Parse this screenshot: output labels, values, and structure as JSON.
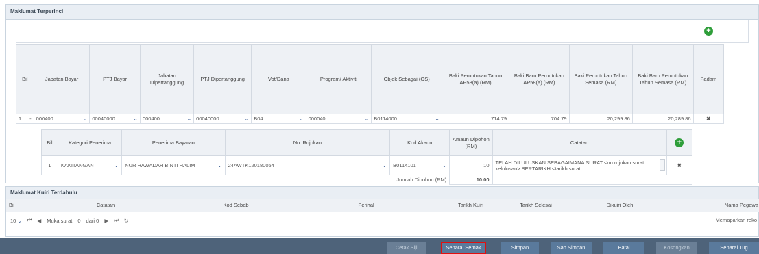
{
  "panel1": {
    "title": "Maklumat Terperinci"
  },
  "main_table": {
    "headers": [
      "Bil",
      "Jabatan Bayar",
      "PTJ Bayar",
      "Jabatan Dipertanggung",
      "PTJ Dipertanggung",
      "Vot/Dana",
      "Program/ Aktiviti",
      "Objek Sebagai (OS)",
      "Baki Peruntukan Tahun AP58(a) (RM)",
      "Baki Baru Peruntukan AP58(a) (RM)",
      "Baki Peruntukan Tahun Semasa (RM)",
      "Baki Baru Peruntukan Tahun Semasa (RM)",
      "Padam"
    ],
    "row": {
      "bil": "1",
      "toggle": "-",
      "jabatan_bayar": "000400",
      "ptj_bayar": "00040000",
      "jabatan_dip": "000400",
      "ptj_dip": "00040000",
      "vot": "B04",
      "program": "000040",
      "objek": "B0114000",
      "baki1": "714.79",
      "baki2": "704.79",
      "baki3": "20,299.86",
      "baki4": "20,289.86"
    }
  },
  "sub_table": {
    "headers": [
      "Bil",
      "Kategori Penerima",
      "Penerima Bayaran",
      "No. Rujukan",
      "Kod Akaun",
      "Amaun Dipohon (RM)",
      "Catatan"
    ],
    "row": {
      "bil": "1",
      "kategori": "KAKITANGAN",
      "penerima": "NUR HAWADAH BINTI HALIM",
      "rujukan": "24AWTK120180054",
      "kod": "B0114101",
      "amaun": "10",
      "catatan": "TELAH DILULUSKAN SEBAGAIMANA SURAT <no rujukan surat kelulusan> BERTARIKH <tarikh surat"
    },
    "sum_label": "Jumlah Dipohon (RM)",
    "sum_value": "10.00"
  },
  "panel2": {
    "title": "Maklumat Kuiri Terdahulu",
    "headers": [
      "Bil",
      "Catatan",
      "Kod Sebab",
      "Perihal",
      "Tarikh Kuiri",
      "Tarikh Selesai",
      "Dikuiri Oleh",
      "Nama Pegawa"
    ],
    "pager": {
      "page_size": "10",
      "page_label": "Muka surat",
      "page": "0",
      "of_label": "dari 0",
      "info": "Memaparkan reko"
    }
  },
  "buttons": {
    "cetak": "Cetak Sijil",
    "senarai_semak": "Senarai Semak",
    "simpan": "Simpan",
    "sah_simpan": "Sah Simpan",
    "batal": "Batal",
    "kosongkan": "Kosongkan",
    "senarai_tugas": "Senarai Tug"
  },
  "colors": {
    "accent_add": "#2f9e3a",
    "delete": "#d42323",
    "highlight": "#e01010",
    "bar": "#4e637a"
  }
}
